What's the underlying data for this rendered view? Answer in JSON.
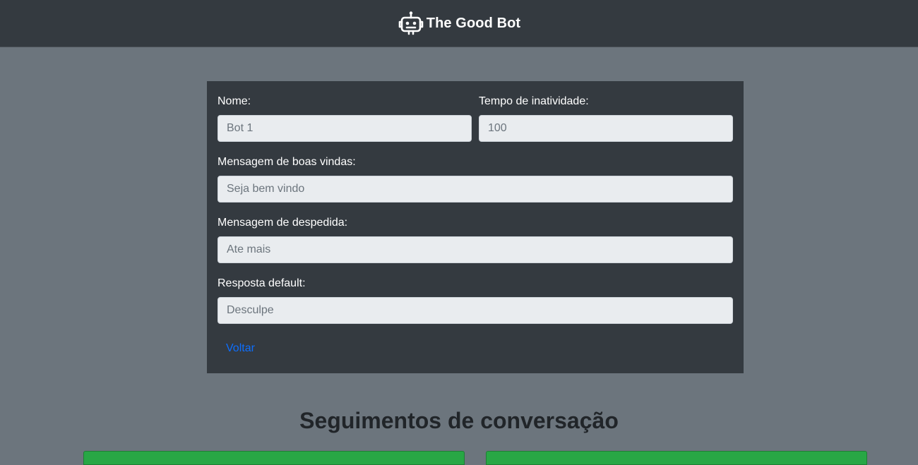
{
  "navbar": {
    "brand_name": "The Good Bot",
    "logo_icon": "robot-icon"
  },
  "form": {
    "nome": {
      "label": "Nome:",
      "placeholder": "Bot 1",
      "value": ""
    },
    "tempo": {
      "label": "Tempo de inatividade:",
      "placeholder": "100",
      "value": ""
    },
    "boas_vindas": {
      "label": "Mensagem de boas vindas:",
      "placeholder": "Seja bem vindo",
      "value": ""
    },
    "despedida": {
      "label": "Mensagem de despedida:",
      "placeholder": "Ate mais",
      "value": ""
    },
    "default": {
      "label": "Resposta default:",
      "placeholder": "Desculpe",
      "value": ""
    },
    "back_label": "Voltar"
  },
  "segments": {
    "title": "Seguimentos de conversação"
  },
  "colors": {
    "navbar_bg": "#343a40",
    "page_bg": "#6c757d",
    "card_bg": "#343a40",
    "input_bg": "#e9ecef",
    "link": "#0d6efd",
    "segment_card": "#28a745"
  }
}
